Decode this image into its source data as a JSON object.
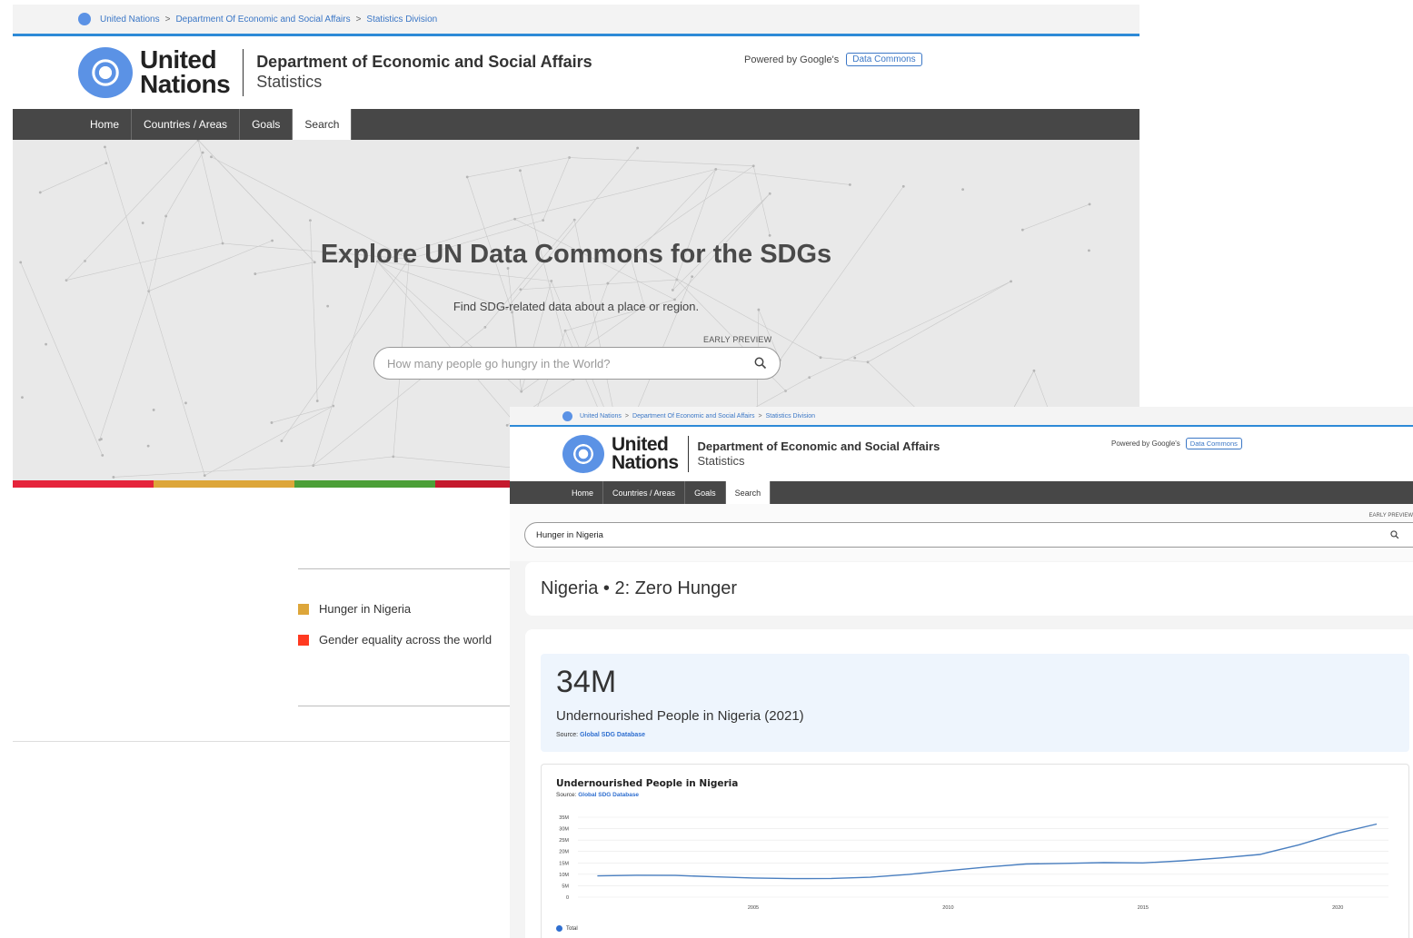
{
  "back": {
    "breadcrumb": [
      "United Nations",
      "Department Of Economic and Social Affairs",
      "Statistics Division"
    ],
    "breadcrumb_sep": ">",
    "logo_line1": "United",
    "logo_line2": "Nations",
    "dept_name": "Department of Economic and Social Affairs",
    "dept_sub": "Statistics",
    "powered_text": "Powered by Google's",
    "powered_badge": "Data Commons",
    "nav": [
      "Home",
      "Countries / Areas",
      "Goals",
      "Search"
    ],
    "active_nav": "Search",
    "hero_title": "Explore UN Data Commons for the SDGs",
    "hero_subtitle": "Find SDG-related data about a place or region.",
    "early_preview": "EARLY PREVIEW",
    "search_placeholder": "How many people go hungry in the World?",
    "topics": [
      {
        "label": "Hunger in Nigeria",
        "color": "#dda63a"
      },
      {
        "label": "Gender equality across the world",
        "color": "#ff3a21"
      }
    ],
    "sdg_colors": [
      "#e5243b",
      "#dda63a",
      "#4c9f38",
      "#c5192d",
      "#ff3a21",
      "#26bde2",
      "#fcc30b",
      "#a21942"
    ]
  },
  "front": {
    "breadcrumb": [
      "United Nations",
      "Department Of Economic and Social Affairs",
      "Statistics Division"
    ],
    "breadcrumb_sep": ">",
    "logo_line1": "United",
    "logo_line2": "Nations",
    "dept_name": "Department of Economic and Social Affairs",
    "dept_sub": "Statistics",
    "powered_text": "Powered by Google's",
    "powered_badge": "Data Commons",
    "nav": [
      "Home",
      "Countries / Areas",
      "Goals",
      "Search"
    ],
    "active_nav": "Search",
    "early_preview": "EARLY PREVIEW",
    "search_value": "Hunger in Nigeria",
    "page_title": "Nigeria • 2: Zero Hunger",
    "highlight_value": "34M",
    "highlight_desc": "Undernourished People in Nigeria (2021)",
    "source_label": "Source:",
    "source_link": "Global SDG Database",
    "chart_title": "Undernourished People in Nigeria",
    "legend_label": "Total"
  },
  "chart_data": {
    "type": "line",
    "title": "Undernourished People in Nigeria",
    "xlabel": "",
    "ylabel": "",
    "x": [
      2001,
      2002,
      2003,
      2004,
      2005,
      2006,
      2007,
      2008,
      2009,
      2010,
      2011,
      2012,
      2013,
      2014,
      2015,
      2016,
      2017,
      2018,
      2019,
      2020,
      2021
    ],
    "series": [
      {
        "name": "Total",
        "values": [
          9.3,
          9.6,
          9.5,
          8.9,
          8.4,
          8.1,
          8.2,
          8.7,
          10.0,
          11.6,
          13.2,
          14.5,
          14.8,
          15.1,
          15.0,
          15.9,
          17.2,
          18.7,
          22.9,
          28.0,
          32.0
        ]
      }
    ],
    "xticks": [
      2005,
      2010,
      2015,
      2020
    ],
    "yticks": [
      "0",
      "5M",
      "10M",
      "15M",
      "20M",
      "25M",
      "30M",
      "35M"
    ],
    "ylim": [
      0,
      35
    ],
    "color": "#4a7fc0",
    "grid": true,
    "legend": "bottom-left"
  }
}
